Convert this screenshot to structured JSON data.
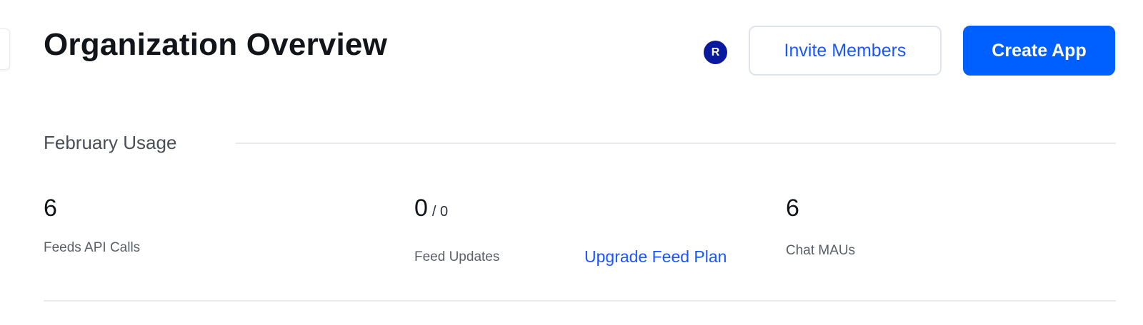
{
  "header": {
    "title": "Organization Overview",
    "avatar_initial": "R",
    "invite_label": "Invite Members",
    "create_label": "Create App"
  },
  "usage": {
    "section_label": "February Usage",
    "stats": [
      {
        "value": "6",
        "label": "Feeds API Calls"
      },
      {
        "value": "0",
        "limit": "/ 0",
        "label": "Feed Updates"
      },
      {
        "value": "6",
        "label": "Chat MAUs"
      }
    ],
    "upgrade_link": "Upgrade Feed Plan"
  },
  "colors": {
    "primary": "#005fff",
    "link": "#1a56ff",
    "avatar_bg": "#0a1a9e"
  }
}
